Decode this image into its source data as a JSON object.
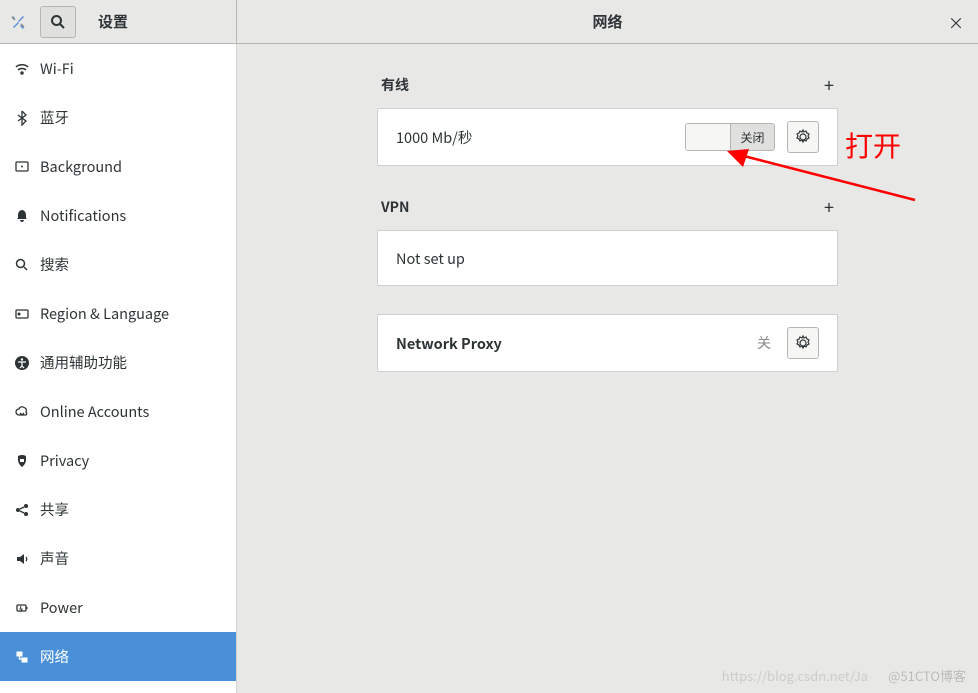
{
  "header": {
    "left_title": "设置",
    "right_title": "网络"
  },
  "sidebar": {
    "items": [
      {
        "label": "Wi-Fi",
        "icon": "wifi"
      },
      {
        "label": "蓝牙",
        "icon": "bluetooth"
      },
      {
        "label": "Background",
        "icon": "background"
      },
      {
        "label": "Notifications",
        "icon": "bell"
      },
      {
        "label": "搜索",
        "icon": "search"
      },
      {
        "label": "Region & Language",
        "icon": "region"
      },
      {
        "label": "通用辅助功能",
        "icon": "accessibility"
      },
      {
        "label": "Online Accounts",
        "icon": "cloud"
      },
      {
        "label": "Privacy",
        "icon": "privacy"
      },
      {
        "label": "共享",
        "icon": "share"
      },
      {
        "label": "声音",
        "icon": "sound"
      },
      {
        "label": "Power",
        "icon": "power"
      },
      {
        "label": "网络",
        "icon": "network",
        "active": true
      }
    ]
  },
  "sections": {
    "wired": {
      "title": "有线",
      "speed": "1000 Mb/秒",
      "toggle_off": "关闭"
    },
    "vpn": {
      "title": "VPN",
      "status": "Not set up"
    },
    "proxy": {
      "title": "Network Proxy",
      "status": "关"
    }
  },
  "annotation": {
    "text": "打开"
  },
  "watermark": {
    "w1": "@51CTO博客",
    "w2": "https://blog.csdn.net/Ja"
  }
}
